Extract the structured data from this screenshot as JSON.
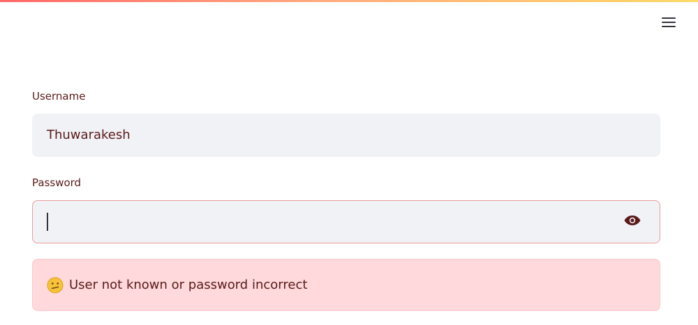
{
  "header": {
    "menu_icon": "hamburger-menu-icon",
    "accent_gradient": [
      "#ff4b4b",
      "#ffd24a"
    ]
  },
  "form": {
    "username": {
      "label": "Username",
      "value": "Thuwarakesh"
    },
    "password": {
      "label": "Password",
      "value": "",
      "toggle_icon": "eye-icon"
    }
  },
  "alert": {
    "icon": "confused-face-icon",
    "message": "User not known or password incorrect",
    "background": "#ffd9db",
    "text_color": "#5a1a1a"
  }
}
